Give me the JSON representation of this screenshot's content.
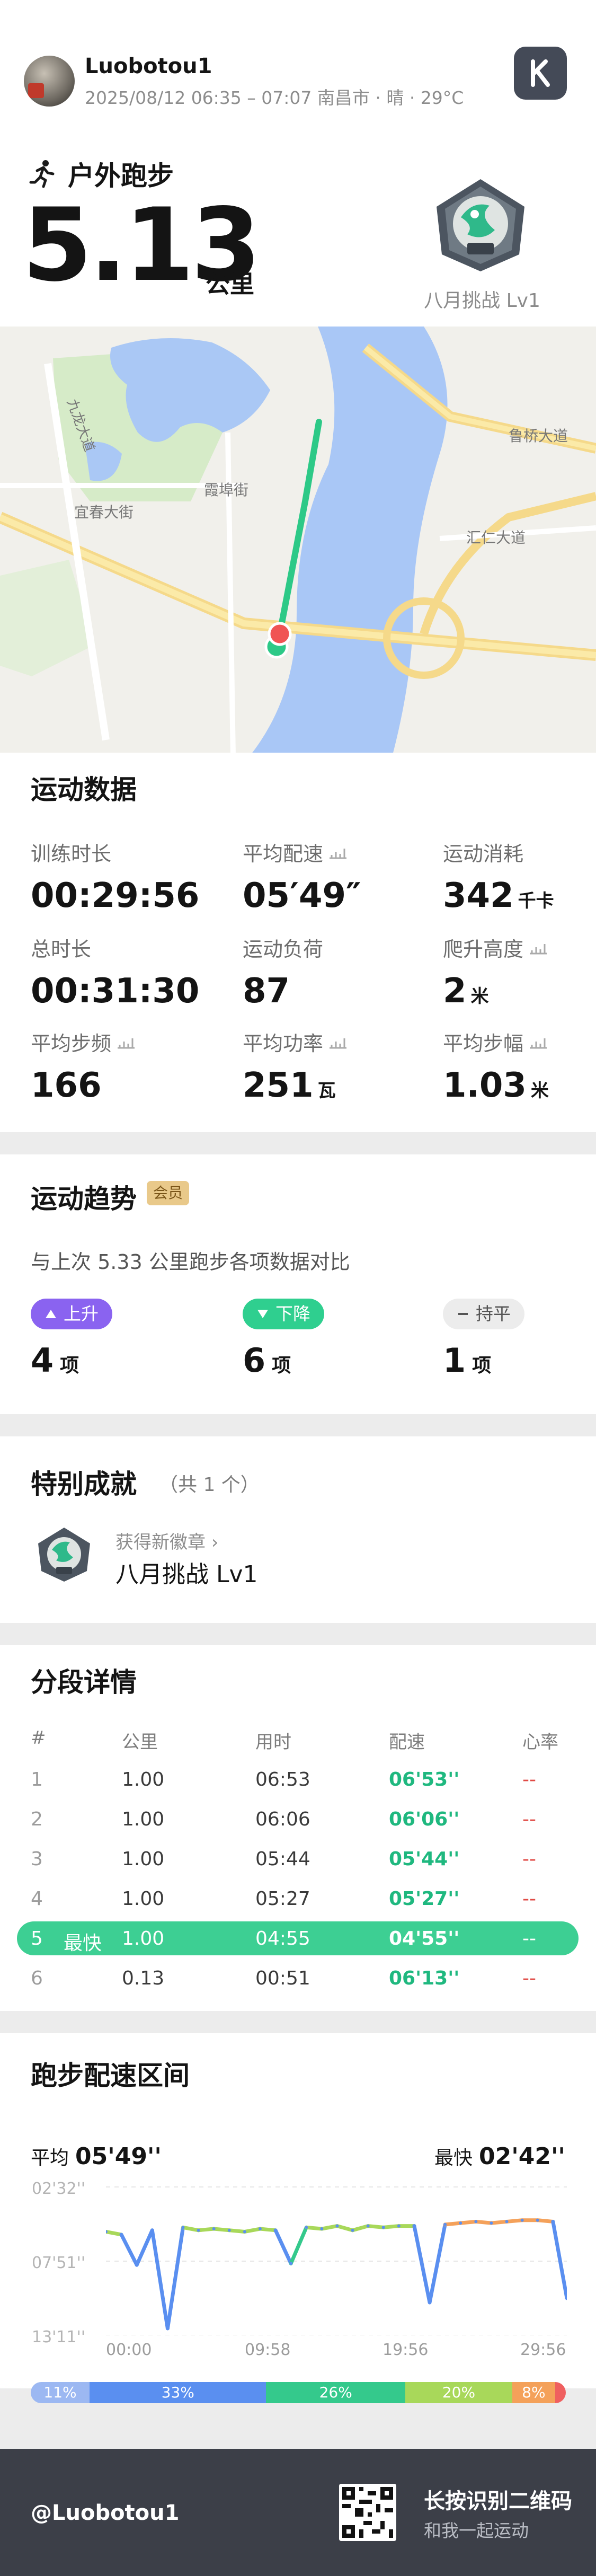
{
  "header": {
    "username": "Luobotou1",
    "meta": "2025/08/12 06:35 – 07:07 南昌市 · 晴 · 29°C",
    "sport": "户外跑步",
    "distance": "5.13",
    "distance_unit": "公里",
    "badge_title": "八月挑战 Lv1",
    "app_logo_letter": "K"
  },
  "map": {
    "labels": {
      "road1": "九龙大道",
      "road2": "宜春大街",
      "road3": "霞埠街",
      "road4": "汇仁大道",
      "road5": "鲁桥大道"
    }
  },
  "data_section": {
    "title": "运动数据",
    "metrics": [
      {
        "label": "训练时长",
        "value": "00:29:56",
        "unit": ""
      },
      {
        "label": "平均配速",
        "value": "05′49″",
        "unit": "",
        "chart_icon": true
      },
      {
        "label": "运动消耗",
        "value": "342",
        "unit": "千卡"
      },
      {
        "label": "总时长",
        "value": "00:31:30",
        "unit": ""
      },
      {
        "label": "运动负荷",
        "value": "87",
        "unit": ""
      },
      {
        "label": "爬升高度",
        "value": "2",
        "unit": "米",
        "chart_icon": true
      },
      {
        "label": "平均步频",
        "value": "166",
        "unit": "",
        "chart_icon": true
      },
      {
        "label": "平均功率",
        "value": "251",
        "unit": "瓦",
        "chart_icon": true
      },
      {
        "label": "平均步幅",
        "value": "1.03",
        "unit": "米",
        "chart_icon": true
      }
    ]
  },
  "trend": {
    "title": "运动趋势",
    "vip": "会员",
    "subtitle": "与上次 5.33 公里跑步各项数据对比",
    "items": [
      {
        "label": "上升",
        "count": "4",
        "unit": "项",
        "color": "#8a63f0"
      },
      {
        "label": "下降",
        "count": "6",
        "unit": "项",
        "color": "#2fcf8f"
      },
      {
        "label": "持平",
        "count": "1",
        "unit": "项",
        "color": "#e9e9e9"
      }
    ]
  },
  "achievements": {
    "title": "特别成就",
    "count": "（共 1 个）",
    "new_label": "获得新徽章",
    "badge_name": "八月挑战 Lv1"
  },
  "splits": {
    "title": "分段详情",
    "headers": [
      "#",
      "公里",
      "用时",
      "配速",
      "心率"
    ],
    "fastest_label": "最快",
    "rows": [
      {
        "idx": "1",
        "km": "1.00",
        "time": "06:53",
        "pace": "06'53''",
        "hr": "--"
      },
      {
        "idx": "2",
        "km": "1.00",
        "time": "06:06",
        "pace": "06'06''",
        "hr": "--"
      },
      {
        "idx": "3",
        "km": "1.00",
        "time": "05:44",
        "pace": "05'44''",
        "hr": "--"
      },
      {
        "idx": "4",
        "km": "1.00",
        "time": "05:27",
        "pace": "05'27''",
        "hr": "--"
      },
      {
        "idx": "5",
        "km": "1.00",
        "time": "04:55",
        "pace": "04'55''",
        "hr": "--",
        "fastest": true
      },
      {
        "idx": "6",
        "km": "0.13",
        "time": "00:51",
        "pace": "06'13''",
        "hr": "--"
      }
    ]
  },
  "zone": {
    "title": "跑步配速区间",
    "avg_label": "平均",
    "avg_value": "05'49''",
    "fast_label": "最快",
    "fast_value": "02'42''",
    "segments": [
      {
        "label": "11%",
        "value": 11,
        "color": "#9cb8f2"
      },
      {
        "label": "33%",
        "value": 33,
        "color": "#5a8ff0"
      },
      {
        "label": "26%",
        "value": 26,
        "color": "#34c98c"
      },
      {
        "label": "20%",
        "value": 20,
        "color": "#a8d85a"
      },
      {
        "label": "8%",
        "value": 8,
        "color": "#f4a15a"
      },
      {
        "label": "",
        "value": 2,
        "color": "#ef5f5f"
      }
    ]
  },
  "chart_data": {
    "type": "line",
    "title": "",
    "xlabel": "",
    "ylabel": "",
    "x_ticks": [
      "00:00",
      "09:58",
      "19:56",
      "29:56"
    ],
    "y_ticks": [
      "02'32''",
      "07'51''",
      "13'11''"
    ],
    "y_inverted": true,
    "x": [
      0,
      1,
      2,
      3,
      4,
      5,
      6,
      7,
      8,
      9,
      10,
      11,
      12,
      13,
      14,
      15,
      16,
      17,
      18,
      19,
      20,
      21,
      22,
      23,
      24,
      25,
      26,
      27,
      28,
      29,
      29.9
    ],
    "series": [
      {
        "values": [
          6.0,
          6.2,
          8.3,
          5.9,
          12.7,
          5.7,
          5.9,
          5.8,
          5.9,
          6.0,
          5.8,
          5.9,
          8.2,
          5.7,
          5.8,
          5.6,
          5.9,
          5.6,
          5.7,
          5.6,
          5.6,
          10.9,
          5.5,
          5.4,
          5.3,
          5.4,
          5.3,
          5.2,
          5.2,
          5.3,
          10.6
        ]
      }
    ]
  },
  "footer": {
    "user": "@Luobotou1",
    "line1": "长按识别二维码",
    "line2": "和我一起运动"
  }
}
